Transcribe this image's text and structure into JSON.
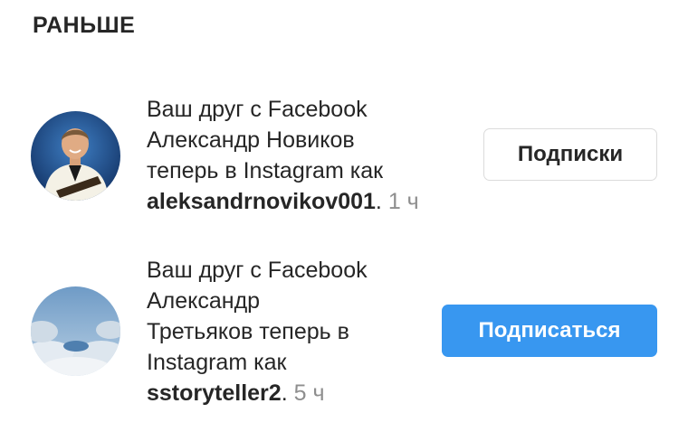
{
  "section": {
    "title": "РАНЬШЕ"
  },
  "notifications": [
    {
      "line1": "Ваш друг с Facebook",
      "line2": "Александр Новиков",
      "line3": "теперь в Instagram как",
      "username": "aleksandrnovikov001",
      "separator": ".",
      "time": " 1 ч",
      "avatar_icon": "user-photo-avatar-icon",
      "button_label": "Подписки"
    },
    {
      "line1": "Ваш друг с Facebook",
      "line2": "Александр",
      "line3": "Третьяков теперь в",
      "line4": "Instagram как",
      "username": "sstoryteller2",
      "separator": ".",
      "time": " 5 ч",
      "avatar_icon": "sky-clouds-avatar-icon",
      "button_label": "Подписаться"
    }
  ],
  "colors": {
    "text": "#262626",
    "muted": "#8e8e8e",
    "follow_button": "#3897f0",
    "border": "#dbdbdb"
  }
}
